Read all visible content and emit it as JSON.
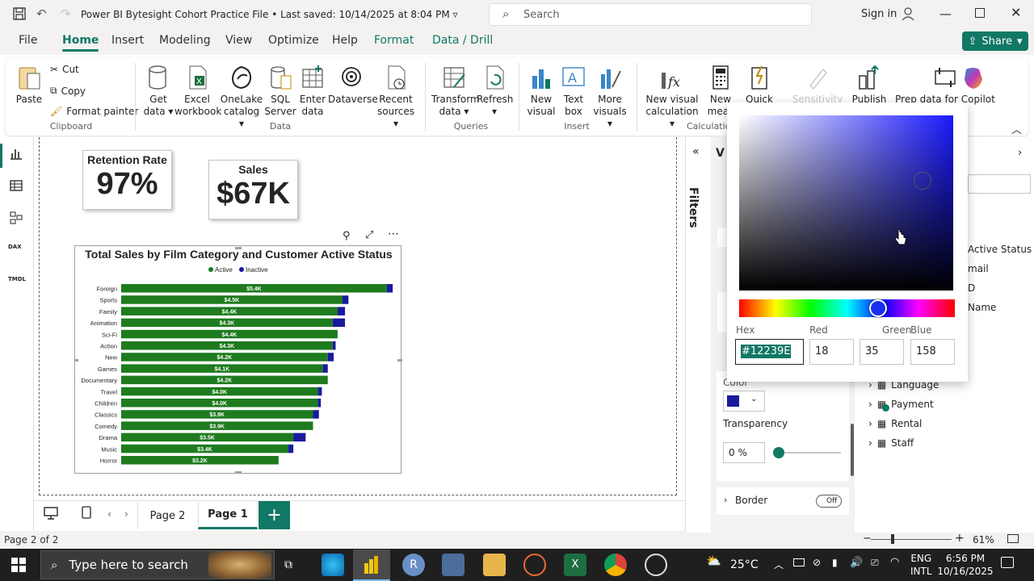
{
  "app": {
    "title": "Power BI Bytesight Cohort Practice File",
    "saved": "Last saved: 10/14/2025 at 8:04 PM",
    "sign_in": "Sign in"
  },
  "search": {
    "label": "Search"
  },
  "menu": {
    "file": "File",
    "home": "Home",
    "insert": "Insert",
    "modeling": "Modeling",
    "view": "View",
    "optimize": "Optimize",
    "help": "Help",
    "format": "Format",
    "data_drill": "Data / Drill",
    "share": "Share"
  },
  "ribbon": {
    "paste": "Paste",
    "cut": "Cut",
    "copy": "Copy",
    "format_painter": "Format painter",
    "clipboard": "Clipboard",
    "get_data": [
      "Get",
      "data"
    ],
    "excel": [
      "Excel",
      "workbook"
    ],
    "onelake": [
      "OneLake",
      "catalog"
    ],
    "sql": [
      "SQL",
      "Server"
    ],
    "enter": [
      "Enter",
      "data"
    ],
    "dataverse": "Dataverse",
    "recent": [
      "Recent",
      "sources"
    ],
    "data_group": "Data",
    "transform": [
      "Transform",
      "data"
    ],
    "refresh": "Refresh",
    "queries_group": "Queries",
    "new_visual": [
      "New",
      "visual"
    ],
    "text_box": [
      "Text",
      "box"
    ],
    "more_visuals": [
      "More",
      "visuals"
    ],
    "insert_group": "Insert",
    "new_visual_calc": [
      "New visual",
      "calculation"
    ],
    "new_measure": [
      "New",
      "meas"
    ],
    "quick": "Quick",
    "calc_group": "Calculation",
    "sensitivity": "Sensitivity",
    "publish": "Publish",
    "prep_copilot": "Prep data for Copilot"
  },
  "cards": [
    {
      "label": "Retention Rate",
      "value": "97%"
    },
    {
      "label": "Sales",
      "value": "$67K"
    }
  ],
  "chart_data": {
    "type": "bar",
    "title": "Total Sales by Film Category and Customer Active Status",
    "legend": [
      "Active",
      "Inactive"
    ],
    "legend_placement": "top-center",
    "categories": [
      "Foreign",
      "Sports",
      "Family",
      "Animation",
      "Sci-Fi",
      "Action",
      "New",
      "Games",
      "Documentary",
      "Travel",
      "Children",
      "Classics",
      "Comedy",
      "Drama",
      "Music",
      "Horror"
    ],
    "series": [
      {
        "name": "Active",
        "color": "#1e7b1e",
        "values": [
          5.4,
          4.5,
          4.4,
          4.3,
          4.4,
          4.3,
          4.2,
          4.1,
          4.2,
          4.0,
          4.0,
          3.9,
          3.9,
          3.5,
          3.4,
          3.2
        ],
        "labels": [
          "$5.4K",
          "$4.5K",
          "$4.4K",
          "$4.3K",
          "$4.4K",
          "$4.3K",
          "$4.2K",
          "$4.1K",
          "$4.2K",
          "$4.0K",
          "$4.0K",
          "$3.9K",
          "$3.9K",
          "$3.5K",
          "$3.4K",
          "$3.2K"
        ]
      },
      {
        "name": "Inactive",
        "color": "#1a1a9e",
        "values": [
          0.12,
          0.12,
          0.15,
          0.25,
          0.0,
          0.06,
          0.12,
          0.1,
          0.0,
          0.08,
          0.06,
          0.12,
          0.0,
          0.25,
          0.1,
          0.0
        ]
      }
    ],
    "xlim": [
      0,
      5.6
    ]
  },
  "tabs": {
    "page2": "Page 2",
    "page1": "Page 1",
    "add": "+"
  },
  "status": {
    "page": "Page 2 of 2",
    "zoom": "61%"
  },
  "filters_label": "Filters",
  "format_pane": {
    "color_label": "Color",
    "color_value": "#1a1a9e",
    "transparency_label": "Transparency",
    "transparency_value": "0 %",
    "border_label": "Border",
    "border_toggle": "Off"
  },
  "color_picker": {
    "hex_label": "Hex",
    "red_label": "Red",
    "green_label": "Green",
    "blue_label": "Blue",
    "hex": "#12239E",
    "red": "18",
    "green": "35",
    "blue": "158"
  },
  "data_pane": {
    "fields_partial": [
      "Active Status",
      "mail",
      "D",
      "Name"
    ],
    "tables": [
      "Language",
      "Payment",
      "Rental",
      "Staff"
    ]
  },
  "taskbar": {
    "search_placeholder": "Type here to search",
    "temp": "25°C",
    "lang1": "ENG",
    "lang2": "INTL",
    "time": "6:56 PM",
    "date": "10/16/2025"
  }
}
